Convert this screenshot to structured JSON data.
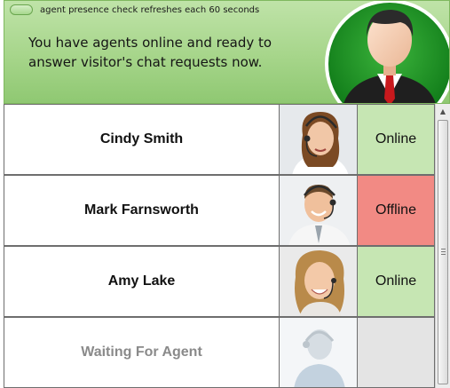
{
  "header": {
    "refresh_text": "agent presence check refreshes each 60 seconds",
    "message": "You have agents online and ready to answer visitor's chat requests now.",
    "background_color": "#a6d58a",
    "avatar_icon": "agent-silhouette-icon"
  },
  "agents": [
    {
      "name": "Cindy Smith",
      "status": "Online",
      "status_color": "#c6e6b3",
      "photo": "female-agent-headset-photo"
    },
    {
      "name": "Mark Farnsworth",
      "status": "Offline",
      "status_color": "#f28a84",
      "photo": "male-agent-headset-photo"
    },
    {
      "name": "Amy Lake",
      "status": "Online",
      "status_color": "#c6e6b3",
      "photo": "female-agent-headset-photo"
    },
    {
      "name": "Waiting For Agent",
      "status": "",
      "status_color": "#e4e4e4",
      "photo": "placeholder-agent-icon"
    }
  ],
  "scrollbar": {
    "up_arrow_icon": "scroll-up-arrow-icon"
  }
}
